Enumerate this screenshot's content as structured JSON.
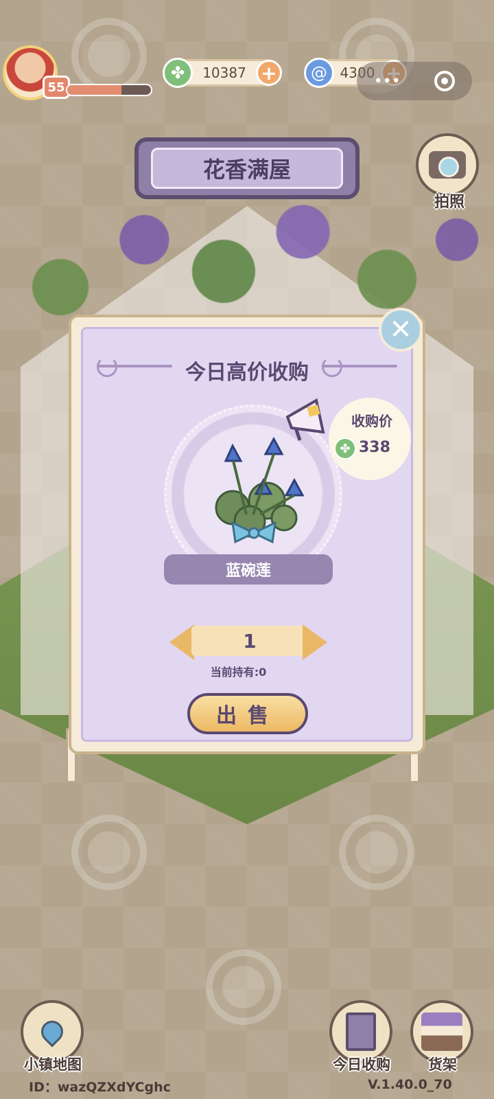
{
  "player": {
    "level": "55",
    "xp_fraction": 0.65
  },
  "currencies": [
    {
      "icon": "clover-icon",
      "value": "10387",
      "color": "#7fbf7a"
    },
    {
      "icon": "swirl-icon",
      "value": "4300",
      "color": "#6a9be0"
    }
  ],
  "capsule": {
    "more_label": "•••"
  },
  "camera": {
    "label": "拍照"
  },
  "shop": {
    "name": "花香满屋"
  },
  "dialog": {
    "title": "今日高价收购",
    "price_label": "收购价",
    "price_value": "338",
    "item_name": "蓝碗莲",
    "quantity": "1",
    "held_text": "当前持有:0",
    "sell_label": "出售",
    "close_symbol": "✕"
  },
  "bottom": {
    "map_label": "小镇地图",
    "daily_label": "今日收购",
    "shelf_label": "货架"
  },
  "footer": {
    "id_text": "ID：wazQZXdYCghc",
    "version": "V.1.40.0_70"
  }
}
